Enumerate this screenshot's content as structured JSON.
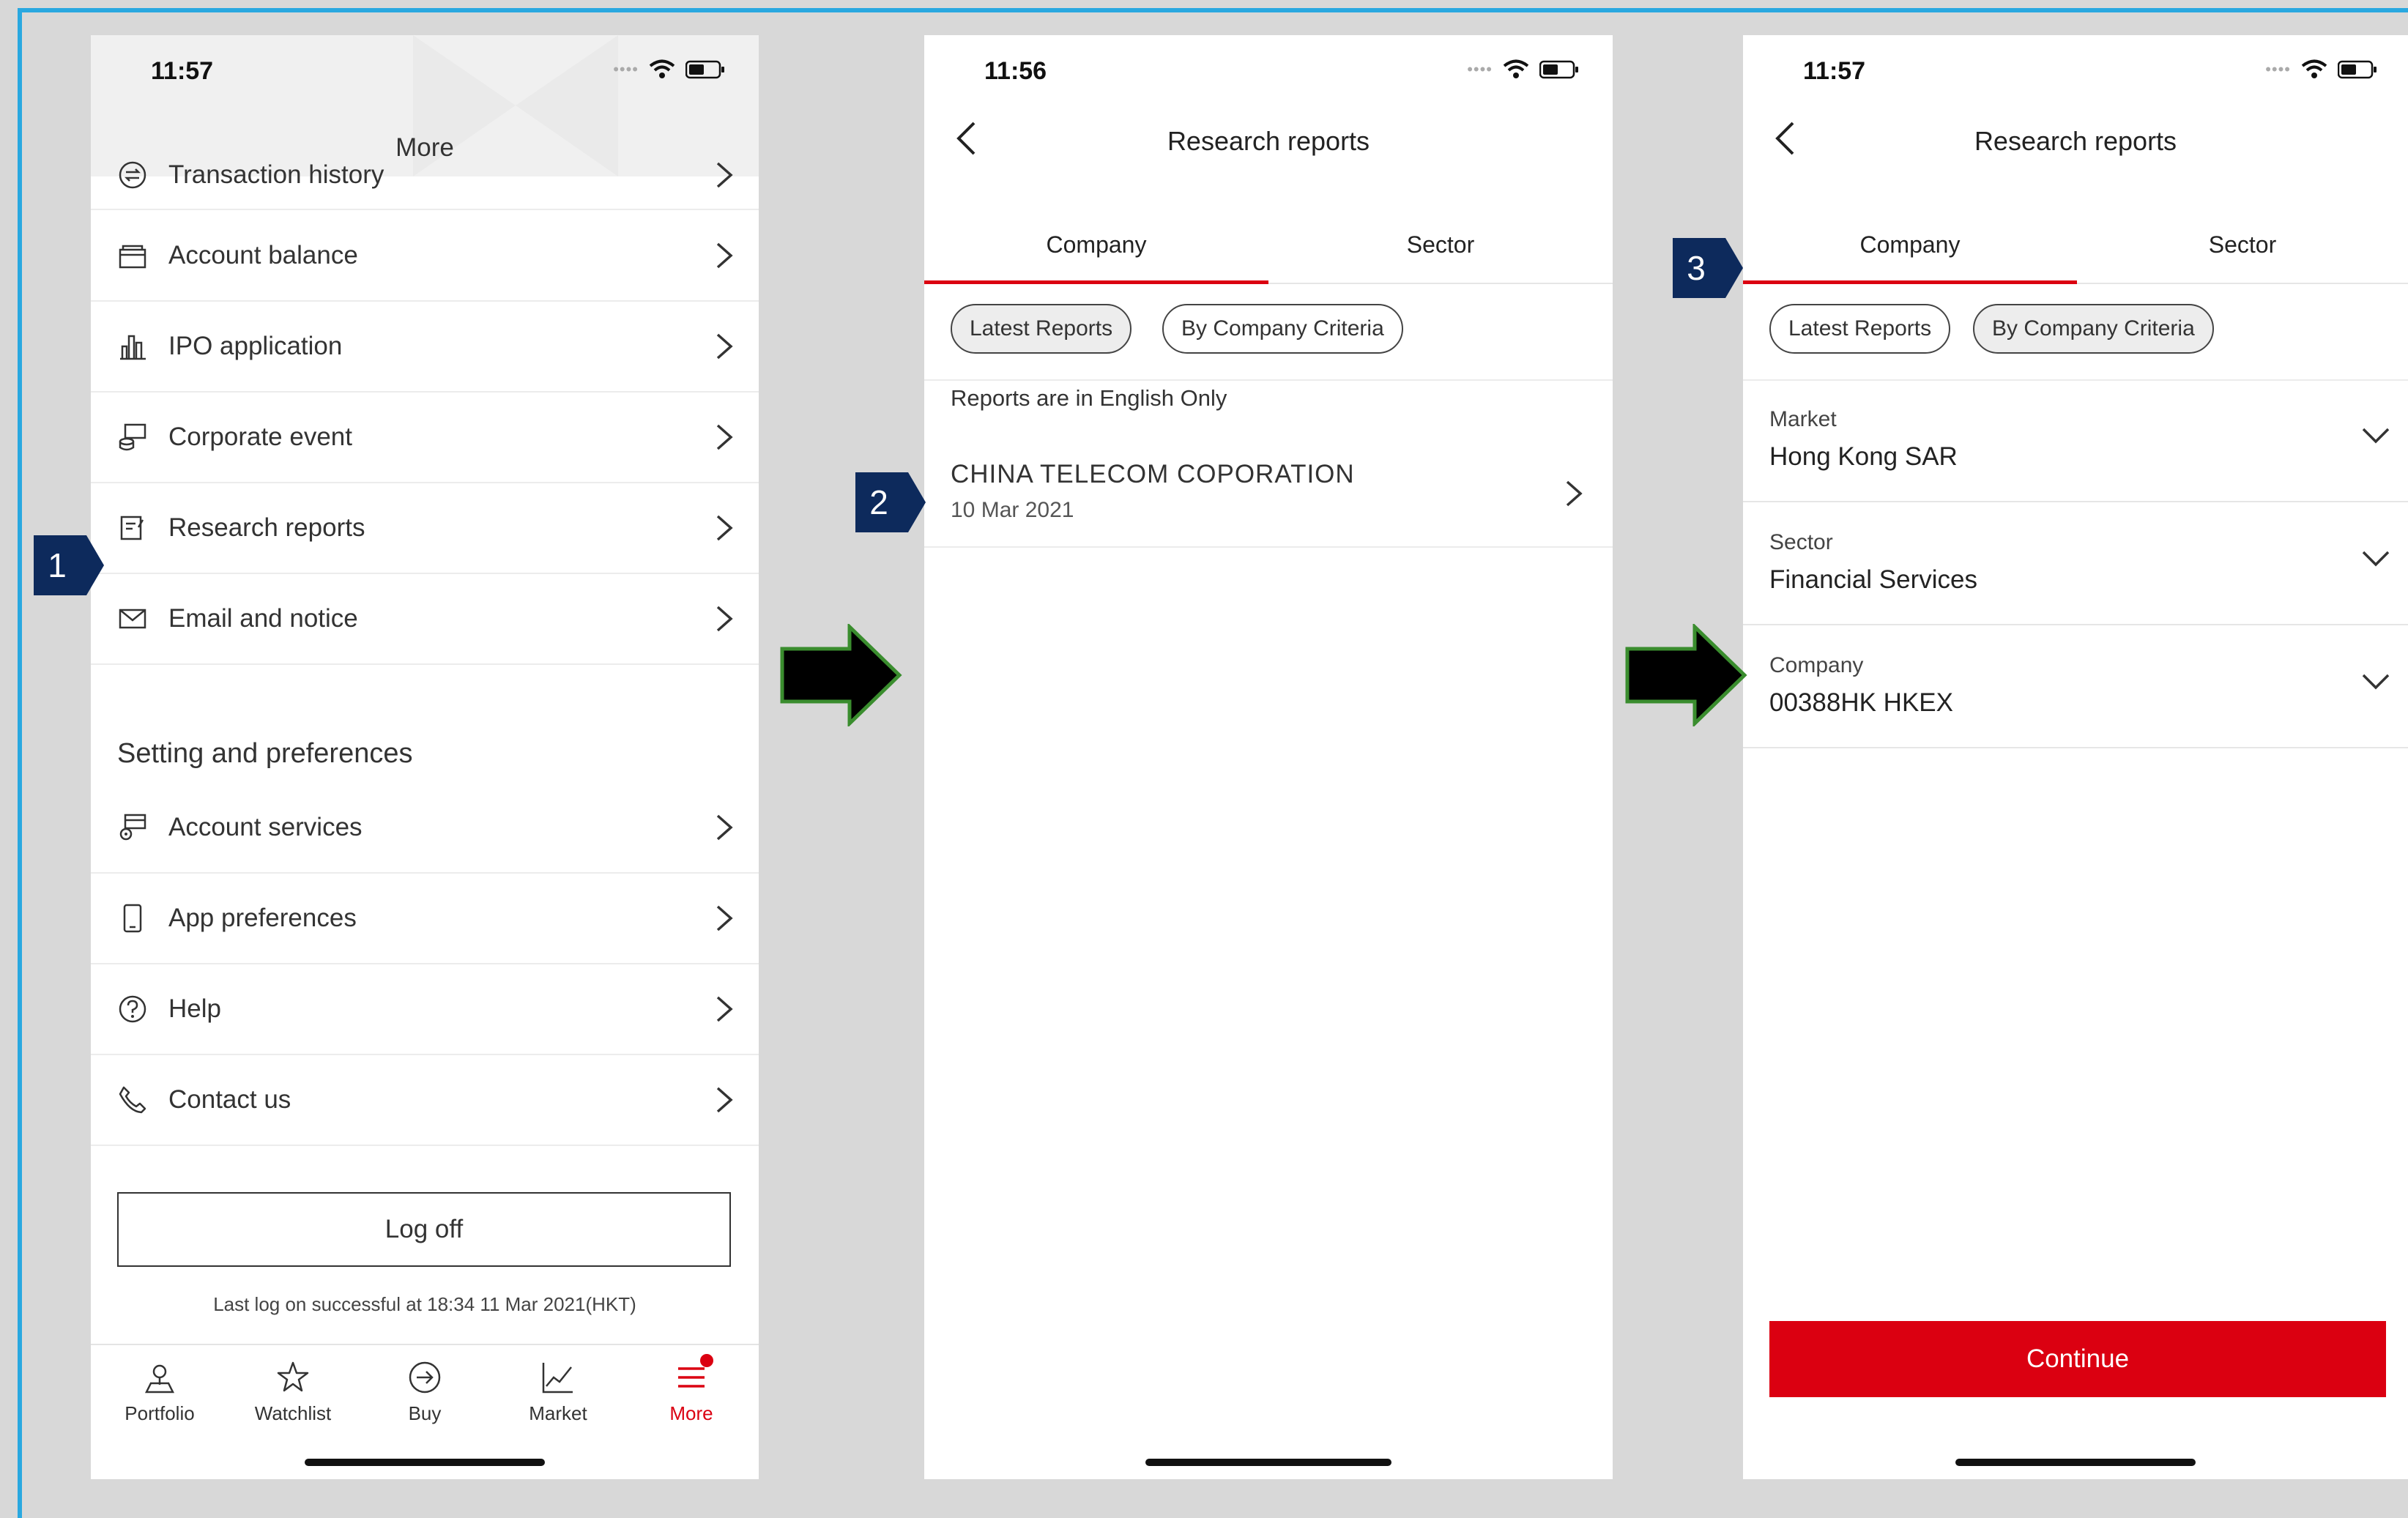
{
  "colors": {
    "accent_red": "#db0011",
    "badge_navy": "#0d2a5c",
    "arrow_green": "#3a8d2e",
    "frame_blue": "#29a8e0"
  },
  "screen1": {
    "time": "11:57",
    "title": "More",
    "menu_items": [
      {
        "label": "Transaction history",
        "icon": "exchange-icon"
      },
      {
        "label": "Account balance",
        "icon": "wallet-icon"
      },
      {
        "label": "IPO application",
        "icon": "bar-chart-icon"
      },
      {
        "label": "Corporate event",
        "icon": "coins-icon"
      },
      {
        "label": "Research reports",
        "icon": "report-icon"
      },
      {
        "label": "Email and notice",
        "icon": "envelope-icon"
      }
    ],
    "section_title": "Setting and preferences",
    "settings_items": [
      {
        "label": "Account services",
        "icon": "account-services-icon"
      },
      {
        "label": "App preferences",
        "icon": "phone-icon"
      },
      {
        "label": "Help",
        "icon": "question-icon"
      },
      {
        "label": "Contact us",
        "icon": "telephone-icon"
      }
    ],
    "logoff_label": "Log off",
    "last_log": "Last log on successful at 18:34 11 Mar 2021(HKT)",
    "tabbar": [
      {
        "label": "Portfolio",
        "icon": "portfolio-icon"
      },
      {
        "label": "Watchlist",
        "icon": "star-icon"
      },
      {
        "label": "Buy",
        "icon": "arrow-circle-icon"
      },
      {
        "label": "Market",
        "icon": "line-chart-icon"
      },
      {
        "label": "More",
        "icon": "menu-icon",
        "active": true
      }
    ]
  },
  "screen2": {
    "time": "11:56",
    "title": "Research reports",
    "tabs": [
      "Company",
      "Sector"
    ],
    "chips": [
      "Latest Reports",
      "By Company Criteria"
    ],
    "notice": "Reports are in English Only",
    "report": {
      "name": "CHINA TELECOM COPORATION",
      "date": "10 Mar 2021"
    }
  },
  "screen3": {
    "time": "11:57",
    "title": "Research reports",
    "tabs": [
      "Company",
      "Sector"
    ],
    "chips": [
      "Latest Reports",
      "By Company Criteria"
    ],
    "fields": [
      {
        "label": "Market",
        "value": "Hong Kong SAR"
      },
      {
        "label": "Sector",
        "value": "Financial Services"
      },
      {
        "label": "Company",
        "value": "00388HK HKEX"
      }
    ],
    "continue_label": "Continue"
  },
  "steps": [
    "1",
    "2",
    "3"
  ]
}
